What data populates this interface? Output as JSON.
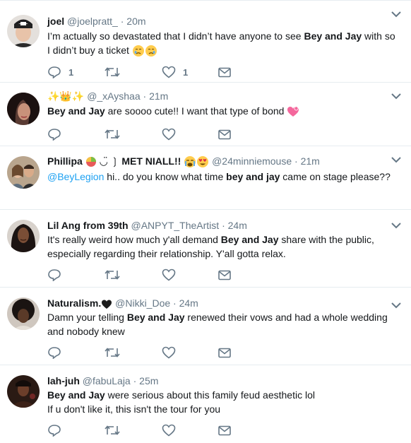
{
  "tweets": [
    {
      "name": "joel",
      "handle": "@joelpratt_",
      "time": "20m",
      "text_pre": "I’m actually so devastated that I didn’t have anyone to see ",
      "highlight": "Bey and Jay",
      "text_post": " with so I didn’t buy a ticket",
      "replies": "1",
      "likes": "1"
    },
    {
      "name_emoji": "✨👑✨",
      "handle": "@_xAyshaa",
      "time": "21m",
      "highlight": "Bey and Jay",
      "text_post": " are soooo cute!! I want that type of bond"
    },
    {
      "name": "Phillipa",
      "name_mid": "◡̈ ❳",
      "name_tail": "MET NIALL!!",
      "handle": "@24minniemouse",
      "time": "21m",
      "mention": "@BeyLegion",
      "text_pre": " hi.. do you know what time ",
      "highlight": "bey and jay",
      "text_post": " came on stage please??"
    },
    {
      "name": "Lil Ang from 39th",
      "handle": "@ANPYT_TheArtist",
      "time": "24m",
      "text_pre": "It's really weird how much y'all demand ",
      "highlight": "Bey and Jay",
      "text_post": " share with the public, especially regarding their relationship. Y'all gotta relax."
    },
    {
      "name": "Naturalism.",
      "handle": "@Nikki_Doe",
      "time": "24m",
      "text_pre": "Damn your telling ",
      "highlight": "Bey and Jay",
      "text_post": " renewed their vows and had a whole wedding and nobody knew"
    },
    {
      "name": "lah-juh",
      "handle": "@fabuLaja",
      "time": "25m",
      "highlight": "Bey and Jay",
      "text_post": " were serious about this family feud aesthetic lol",
      "line2": "If u don't like it, this isn't the tour for you"
    }
  ],
  "separator": "·",
  "colors": {
    "link": "#1da1f2",
    "meta": "#657786",
    "icon": "#657786",
    "heart_pink": "#e0245e"
  }
}
